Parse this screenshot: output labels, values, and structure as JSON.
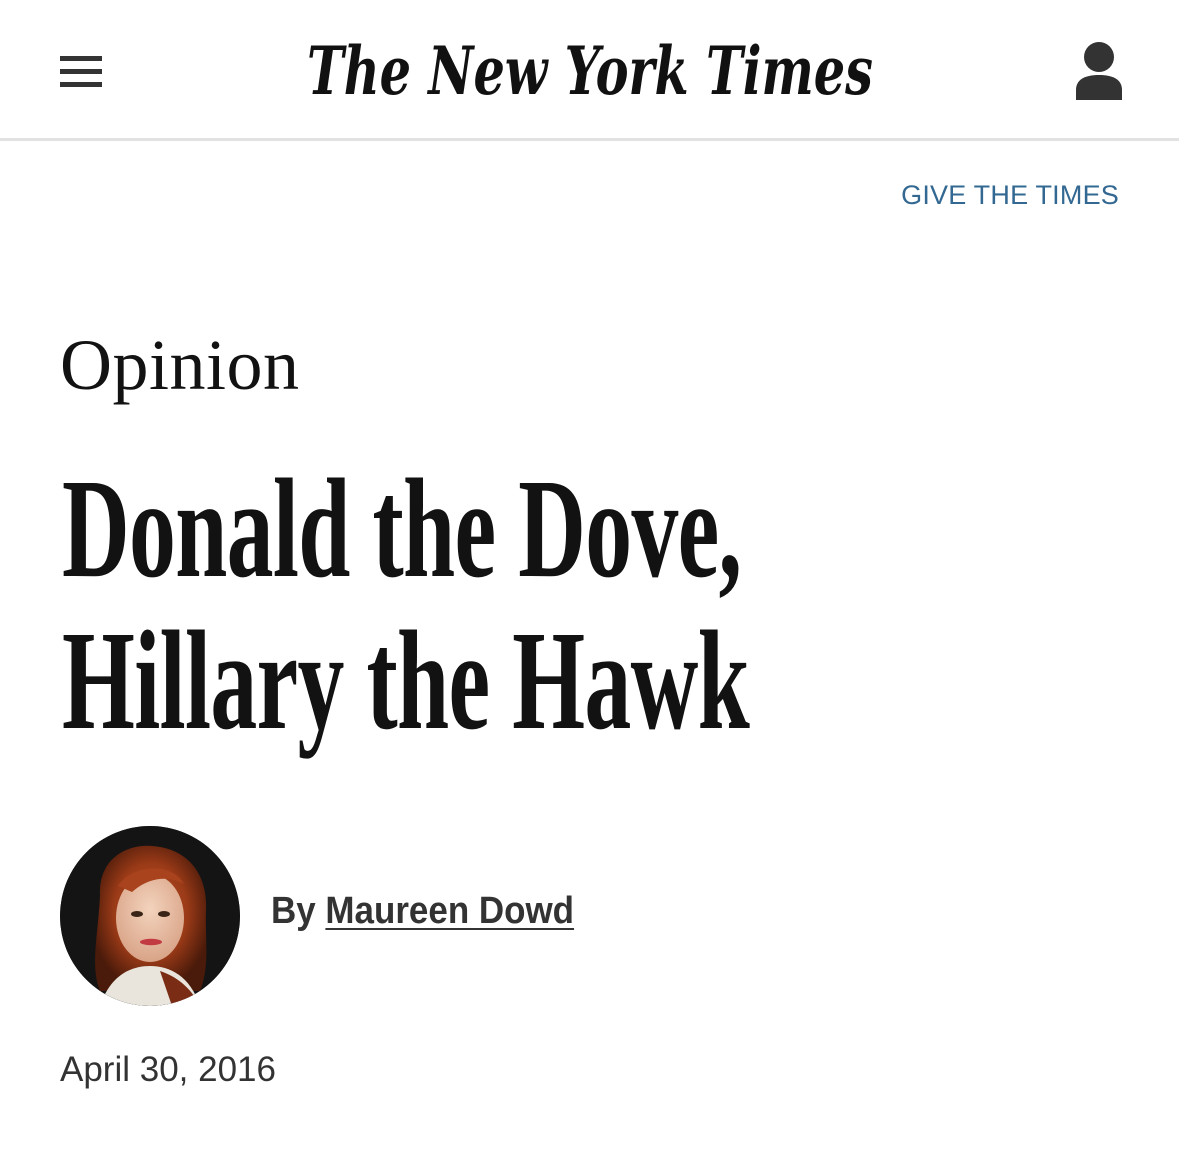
{
  "header": {
    "masthead": "The New York Times",
    "menu_icon": "hamburger-menu-icon",
    "account_icon": "user-account-icon"
  },
  "promo": {
    "give_link": "GIVE THE TIMES",
    "link_color": "#326891"
  },
  "article": {
    "section": "Opinion",
    "headline_line1": "Donald the Dove,",
    "headline_line2": "Hillary the Hawk",
    "byline_prefix": "By",
    "author": "Maureen Dowd",
    "date": "April 30, 2016"
  }
}
